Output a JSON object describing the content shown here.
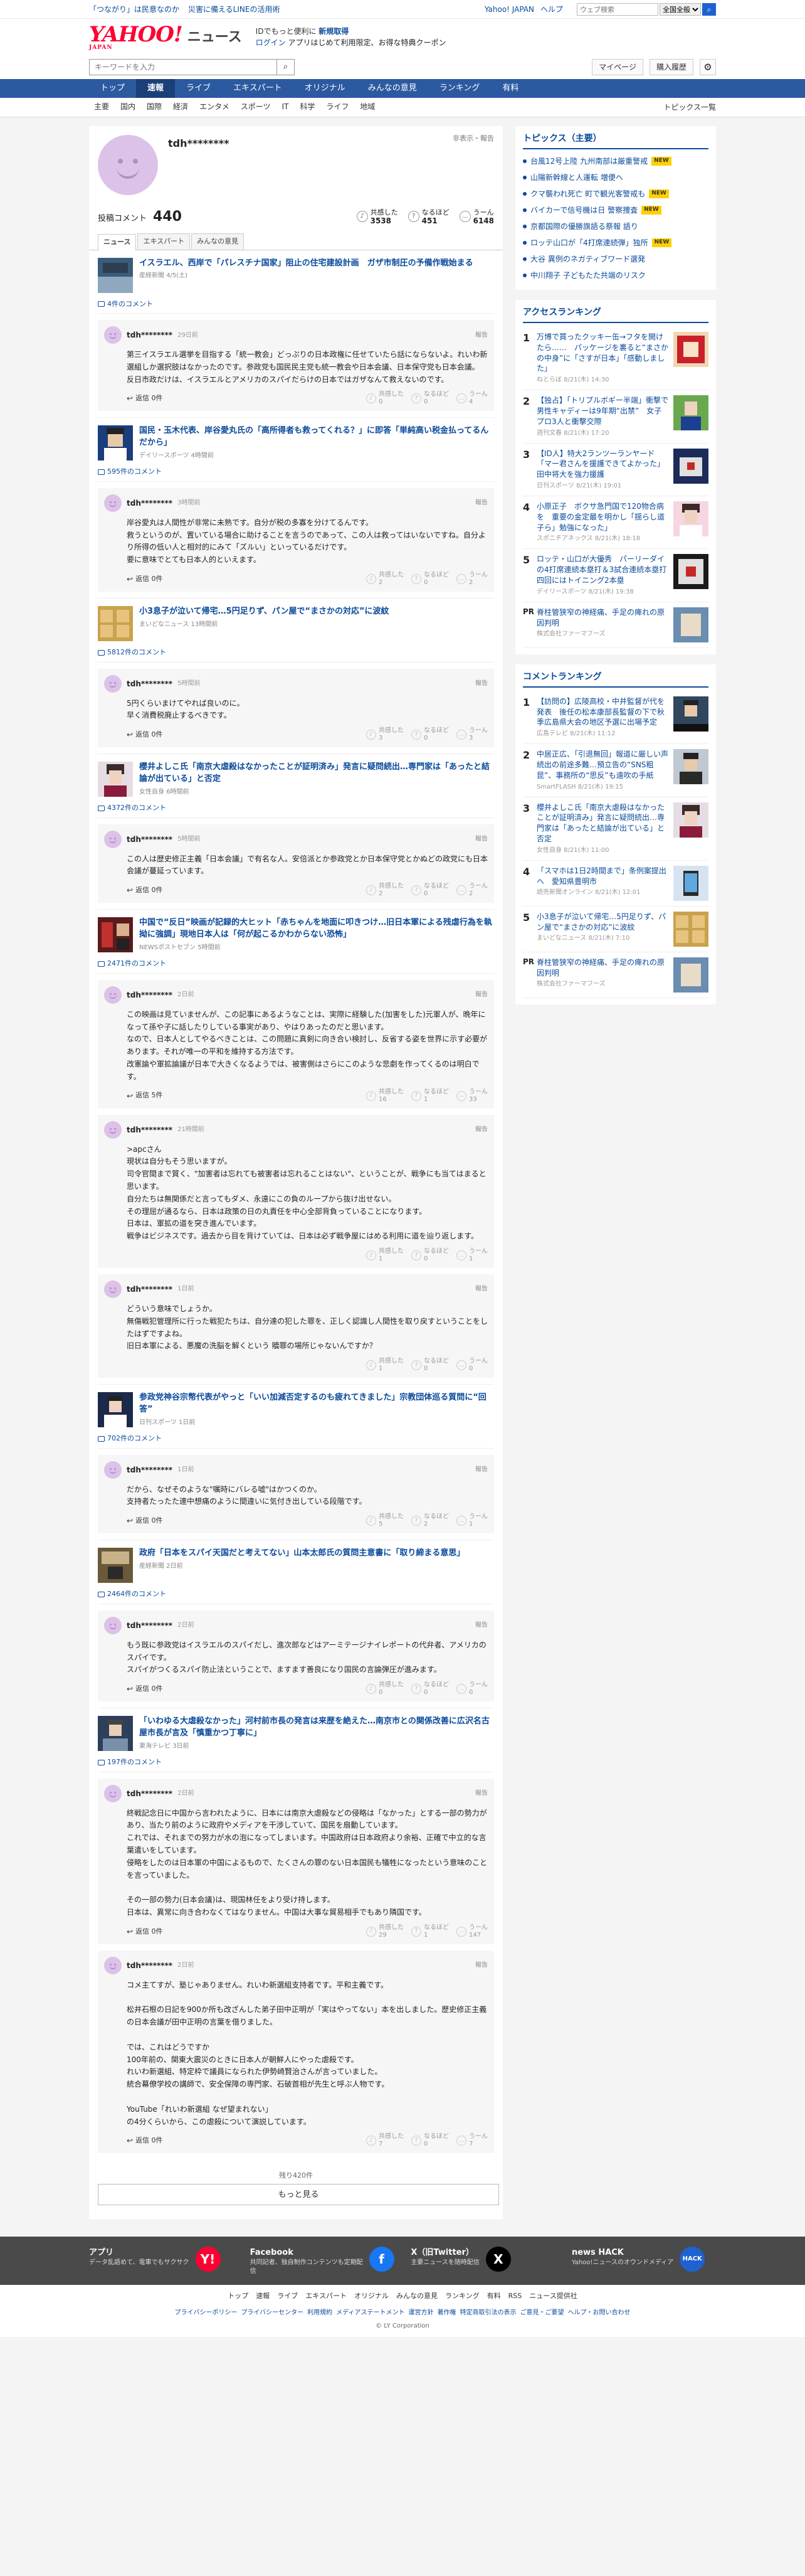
{
  "topbar": {
    "left_links": [
      "「つながり」は民意なのか",
      "災害に備えるLINEの活用術"
    ],
    "right_links": [
      "Yahoo! JAPAN",
      "ヘルプ"
    ],
    "search_placeholder": "ウェブ検索",
    "search_scope": "全国全般"
  },
  "masthead": {
    "logo": "YAHOO!",
    "logo_sub": "JAPAN",
    "service": "ニュース",
    "msg_line1": "IDでもっと便利に",
    "msg_line1_link": "新規取得",
    "msg_login": "ログイン",
    "msg_line2": "アプリはじめて利用限定、お得な特典クーポン"
  },
  "searchrow": {
    "placeholder": "キーワードを入力",
    "mypage": "マイページ",
    "purchase": "購入履歴"
  },
  "mainnav": [
    "トップ",
    "速報",
    "ライブ",
    "エキスパート",
    "オリジナル",
    "みんなの意見",
    "ランキング",
    "有料"
  ],
  "subnav": [
    "主要",
    "国内",
    "国際",
    "経済",
    "エンタメ",
    "スポーツ",
    "IT",
    "科学",
    "ライフ",
    "地域"
  ],
  "subnav_right": "トピックス一覧",
  "profile": {
    "name": "tdh********",
    "report": "非表示・報告",
    "post_label": "投稿コメント",
    "post_count": "440",
    "reactions": [
      {
        "icon": "♪",
        "label": "共感した",
        "count": "3538"
      },
      {
        "icon": "?",
        "label": "なるほど",
        "count": "451"
      },
      {
        "icon": "…",
        "label": "うーん",
        "count": "6148"
      }
    ],
    "tabs": [
      "ニュース",
      "エキスパート",
      "みんなの意見"
    ]
  },
  "blocks": [
    {
      "title": "イスラエル、西岸で「パレスチナ国家」阻止の住宅建設計画　ガザ市制圧の予備作戦始まる",
      "source": "産経新聞 ",
      "source_time": "4/5(土)",
      "comment_count": "4件のコメント",
      "thumb": "t1",
      "comments": [
        {
          "user": "tdh********",
          "time": "29日前",
          "report": "報告",
          "text": "第三イスラエル選挙を目指する「統一教会」どっぷりの日本政権に任せていたら話にならないよ。れいわ新選組しか選択肢はなかったのです。参政党も国民民主党も統一教会や日本会議、日本保守党も日本会議。\n反日市政だけは、イスラエルとアメリカのスパイだらけの日本ではガザなんて救えないのです。",
          "reply": "返信 0件",
          "r": [
            "0",
            "0",
            "4"
          ]
        }
      ]
    },
    {
      "title": "国民・玉木代表、岸谷愛丸氏の「高所得者も救ってくれる？」に即答「単純高い税金払ってるんだから」",
      "source": "デイリースポーツ ",
      "source_time": "4時間前",
      "comment_count": "595件のコメント",
      "thumb": "t2",
      "comments": [
        {
          "user": "tdh********",
          "time": "3時間前",
          "report": "報告",
          "text": "岸谷愛丸は人間性が非常に未熟です。自分が税の多寡を分けてるんです。\n救うというのが、置いている場合に助けることを言うのであって、この人は救ってはいないですね。自分より所得の低い人と相対的にみて「ズルい」といっているだけです。\n要に意味でとても日本人的といえます。",
          "reply": "返信 0件",
          "r": [
            "2",
            "0",
            "2"
          ]
        }
      ]
    },
    {
      "title": "小3息子が泣いて帰宅…5円足りず、パン屋で“まさかの対応”に波紋",
      "source": "まいどなニュース ",
      "source_time": "13時間前",
      "comment_count": "5812件のコメント",
      "thumb": "t3",
      "comments": [
        {
          "user": "tdh********",
          "time": "5時間前",
          "report": "報告",
          "text": "5円くらいまけてやれば良いのに。\n早く消費税廃止するべきです。",
          "reply": "返信 0件",
          "r": [
            "3",
            "0",
            "3"
          ]
        }
      ]
    },
    {
      "title": "櫻井よしこ氏「南京大虐殺はなかったことが証明済み」発言に疑問続出…専門家は「あったと結論が出ている」と否定",
      "source": "女性自身 ",
      "source_time": "6時間前",
      "comment_count": "4372件のコメント",
      "thumb": "t4",
      "comments": [
        {
          "user": "tdh********",
          "time": "5時間前",
          "report": "報告",
          "text": "この人は歴史修正主義「日本会議」で有名な人。安倍派とか参政党とか日本保守党とかぬどの政党にも日本会議が蔓延っています。",
          "reply": "返信 0件",
          "r": [
            "2",
            "0",
            "2"
          ]
        }
      ]
    },
    {
      "title": "中国で“反日”映画が記録的大ヒット「赤ちゃんを地面に叩きつけ…旧日本軍による残虐行為を執拗に強調」現地日本人は「何が起こるかわからない恐怖」",
      "source": "NEWSポストセブン ",
      "source_time": "5時間前",
      "comment_count": "2471件のコメント",
      "thumb": "t5",
      "comments": [
        {
          "user": "tdh********",
          "time": "2日前",
          "report": "報告",
          "text": "この映画は見ていませんが、この記事にあるようなことは、実際に経験した(加害をした)元軍人が、晩年になって孫や子に話したりしている事実があり、やはりあったのだと思います。\nなので、日本人としてやるべきことは、この問題に真剣に向き合い検討し、反省する姿を世界に示す必要があります。それが唯一の平和を維持する方法です。\n改憲論や軍拡論議が日本で大きくなるようでは、被害側はさらにこのような悲劇を作ってくるのは明白です。",
          "reply": "返信 5件",
          "r": [
            "16",
            "1",
            "33"
          ]
        },
        {
          "user": "tdh********",
          "time": "21時間前",
          "report": "報告",
          "text": ">apcさん\n現状は自分もそう思いますが。\n司令官間まで質く、\"加害者は忘れても被害者は忘れることはない\"、ということが、戦争にも当てはまると思います。\n自分たちは無関係だと言ってもダメ、永遠にこの負のループから抜け出せない。\nその理屈が通るなら、日本は政策の日の丸責任を中心全部背負っていることになります。\n日本は、軍拡の道を突き進んでいます。\n戦争はビジネスです。過去から目を背けていては、日本は必ず戦争屋にはめる利用に道を辿り返します。",
          "reply": "",
          "r": [
            "1",
            "0",
            "1"
          ]
        },
        {
          "user": "tdh********",
          "time": "1日前",
          "report": "報告",
          "text": "どういう意味でしょうか。\n無傷戦犯管理所に行った戦犯たちは、自分達の犯した罪を、正しく認識し人間性を取り戻すということをしたはずですよね。\n旧日本軍による、悪魔の洗脳を解くという 贖罪の場所じゃないんですか？",
          "reply": "",
          "r": [
            "1",
            "0",
            "0"
          ]
        }
      ]
    },
    {
      "title": "参政党神谷宗幣代表がやっと「いい加減否定するのも疲れてきました」宗教団体巡る質問に“回答”",
      "source": "日刊スポーツ ",
      "source_time": "1日前",
      "comment_count": "702件のコメント",
      "thumb": "t6",
      "comments": [
        {
          "user": "tdh********",
          "time": "1日前",
          "report": "報告",
          "text": "だから、なぜそのような\"嘱時にバレる嘘\"はかつくのか。\n支持者たったた連中想痛のように間違いに気付き出している段階です。",
          "reply": "返信 0件",
          "r": [
            "5",
            "2",
            "1"
          ]
        }
      ]
    },
    {
      "title": "政府「日本をスパイ天国だと考えてない」山本太郎氏の質問主意書に「取り締まる意思」",
      "source": "産経新聞 ",
      "source_time": "2日前",
      "comment_count": "2464件のコメント",
      "thumb": "t7",
      "comments": [
        {
          "user": "tdh********",
          "time": "2日前",
          "report": "報告",
          "text": "もう既に参政党はイスラエルのスパイだし、進次郎などはアーミテージナイレポートの代弁者、アメリカのスパイです。\nスパイがつくるスパイ防止法ということで、ますます善良になり国民の言論弾圧が進みます。",
          "reply": "返信 0件",
          "r": [
            "0",
            "0",
            "0"
          ]
        }
      ]
    },
    {
      "title": "「いわゆる大虐殺なかった」河村前市長の発言は来歴を絶えた…南京市との関係改善に広沢名古屋市長が言及「慎重かつ丁寧に」",
      "source": "東海テレビ ",
      "source_time": "3日前",
      "comment_count": "197件のコメント",
      "thumb": "t8",
      "comments": [
        {
          "user": "tdh********",
          "time": "2日前",
          "report": "報告",
          "text": "終戦記念日に中国から言われたように、日本には南京大虐殺などの侵略は「なかった」とする一部の勢力があり、当たり前のように政府やメディアを干渉していて、国民を扇動しています。\nこれでは、それまでの努力が水の泡になってしまいます。中国政府は日本政府より余裕、正確で中立的な言葉遣いをしています。\n侵略をしたのは日本軍の中国によるもので、たくさんの罪のない日本国民も犠牲になったという意味のことを言っていました。\n\nその一部の勢力(日本会議)は、現国林任をより受け持します。\n日本は、異常に向き合わなくてはなりません。中国は大事な貿易相手でもあり隣国です。",
          "reply": "返信 0件",
          "r": [
            "29",
            "1",
            "147"
          ]
        },
        {
          "user": "tdh********",
          "time": "2日前",
          "report": "報告",
          "text": "コメ主てすが、塾じゃありません。れいわ新選組支持者です。平和主義です。\n\n松井石根の日記を900か所も改ざんした弟子田中正明が「実はやってない」本を出しました。歴史修正主義の日本会議が田中正明の言葉を借りました。\n\nでは、これはどうですか\n100年前の、関東大震災のときに日本人が朝鮮人にやった虐殺です。\nれいわ新選組、特定枠で議員になられた伊勢崎賢治さんが言っていました。\n統合幕僚学校の講師で、安全保障の専門家、石破首相が先生と呼ぶ人物です。\n\nYouTube「れいわ新選組 なぜ望まれない」\nの4分くらいから、この虐殺について演説しています。",
          "reply": "返信 0件",
          "r": [
            "7",
            "0",
            "7"
          ]
        }
      ]
    }
  ],
  "more": {
    "rest": "残り420件",
    "button": "もっと見る"
  },
  "side": {
    "topics_title": "トピックス（主要）",
    "topics": [
      {
        "text": "台風12号上陸 九州南部は厳重警戒",
        "badge": "NEW"
      },
      {
        "text": "山陽新幹線と人運転 増便へ",
        "badge": ""
      },
      {
        "text": "クマ襲われ死亡 町で観光客警戒も",
        "badge": "NEW"
      },
      {
        "text": "バイカーで信号機は日 警察捜査",
        "badge": "NEW"
      },
      {
        "text": "京都国際の優勝旗語る祭報 語り",
        "badge": ""
      },
      {
        "text": "ロッテ山口が「4打席連続弾」独所",
        "badge": "NEW"
      },
      {
        "text": "大谷 異例のネガティブワード選発",
        "badge": ""
      },
      {
        "text": "中川翔子 子どもたた共端のリスク",
        "badge": ""
      }
    ],
    "access_title": "アクセスランキング",
    "access": [
      {
        "rank": "1",
        "title": "万博で買ったクッキー缶→フタを開けたら……　パッケージを裏ると“まさかの中身”に「さすが日本」「感動しました」",
        "src": "ねとらぼ 8/21(木) 14:30",
        "img": "a1"
      },
      {
        "rank": "2",
        "title": "【独占】「トリプルボギー半端」衝撃で男性キャディーは9年期“出禁”　女子プロ3人と衝撃交際",
        "src": "週刊文春 8/21(木) 17:20",
        "img": "a2"
      },
      {
        "rank": "3",
        "title": "【ID人】特大2ランツーランヤード「マー君さんを援護できてよかった」田中将大を強力援護",
        "src": "日刊スポーツ 8/21(木) 19:01",
        "img": "a3"
      },
      {
        "rank": "4",
        "title": "小原正子　ボクサ急門国で120物合病を　重要の金定最を明かし「揺らし道子ら」勉強になった」",
        "src": "スポニチアネックス 8/21(木) 18:18",
        "img": "a4"
      },
      {
        "rank": "5",
        "title": "ロッテ・山口が大優秀　パーリーダイの4打席連続本塁打＆3試合連続本塁打　四回にはトイニング2本塁",
        "src": "デイリースポーツ 8/21(木) 19:38",
        "img": "a5"
      },
      {
        "rank": "PR",
        "title": "脊柱管狭窄の神経痛、手足の痺れの原因判明",
        "src": "株式会社ファーマフーズ",
        "img": "a6"
      }
    ],
    "comment_title": "コメントランキング",
    "commentrank": [
      {
        "rank": "1",
        "title": "【訪問の】広陵高校・中井監督が代を発表　後任の松本康部長監督の下で秋季広島県大会の地区予選に出場予定",
        "src": "広島テレビ 8/21(木) 11:12",
        "img": "c1"
      },
      {
        "rank": "2",
        "title": "中居正広、「引退無回」報道に厳しい声続出の前途多難…預立告の“SNS粗昆”、事務所の“思反”も遠吹の手紙",
        "src": "SmartFLASH 8/21(木) 19:15",
        "img": "c2"
      },
      {
        "rank": "3",
        "title": "櫻井よしこ氏「南京大虐殺はなかったことが証明済み」発言に疑問続出…専門家は「あったと結論が出ている」と否定",
        "src": "女性自身 8/21(木) 11:00",
        "img": "c3"
      },
      {
        "rank": "4",
        "title": "「スマホは1日2時間まで」条例案提出へ　愛知県豊明市",
        "src": "読売新聞オンライン 8/21(木) 12:01",
        "img": "c4"
      },
      {
        "rank": "5",
        "title": "小3息子が泣いて帰宅…5円足りず、パン屋で“まさかの対応”に波紋",
        "src": "まいどなニュース 8/21(木) 7:10",
        "img": "c5"
      },
      {
        "rank": "PR",
        "title": "脊柱管狭窄の神経痛、手足の痺れの原因判明",
        "src": "株式会社ファーマフーズ",
        "img": "c6"
      }
    ]
  },
  "footer": {
    "apps": [
      {
        "title": "アプリ",
        "desc": "データ乱語めて、電車でもサクサク",
        "icon": "Y!"
      },
      {
        "title": "Facebook",
        "desc": "共同記者、独自制作コンテンツも定期配信",
        "icon": "f"
      },
      {
        "title": "X（旧Twitter）",
        "desc": "主要ニュースを随時配信",
        "icon": "X"
      },
      {
        "title": "news HACK",
        "desc": "Yahoo!ニュースのオウンドメディア",
        "icon": "HACK"
      }
    ],
    "nav": [
      "トップ",
      "速報",
      "ライブ",
      "エキスパート",
      "オリジナル",
      "みんなの意見",
      "ランキング",
      "有料",
      "RSS",
      "ニュース提供社"
    ],
    "legal": [
      "プライバシーポリシー",
      "プライバシーセンター",
      "利用規約",
      "メディアステートメント",
      "運営方針",
      "著作権",
      "特定商取引法の表示",
      "ご意見・ご要望",
      "ヘルプ・お問い合わせ"
    ],
    "copyright": "© LY Corporation"
  }
}
